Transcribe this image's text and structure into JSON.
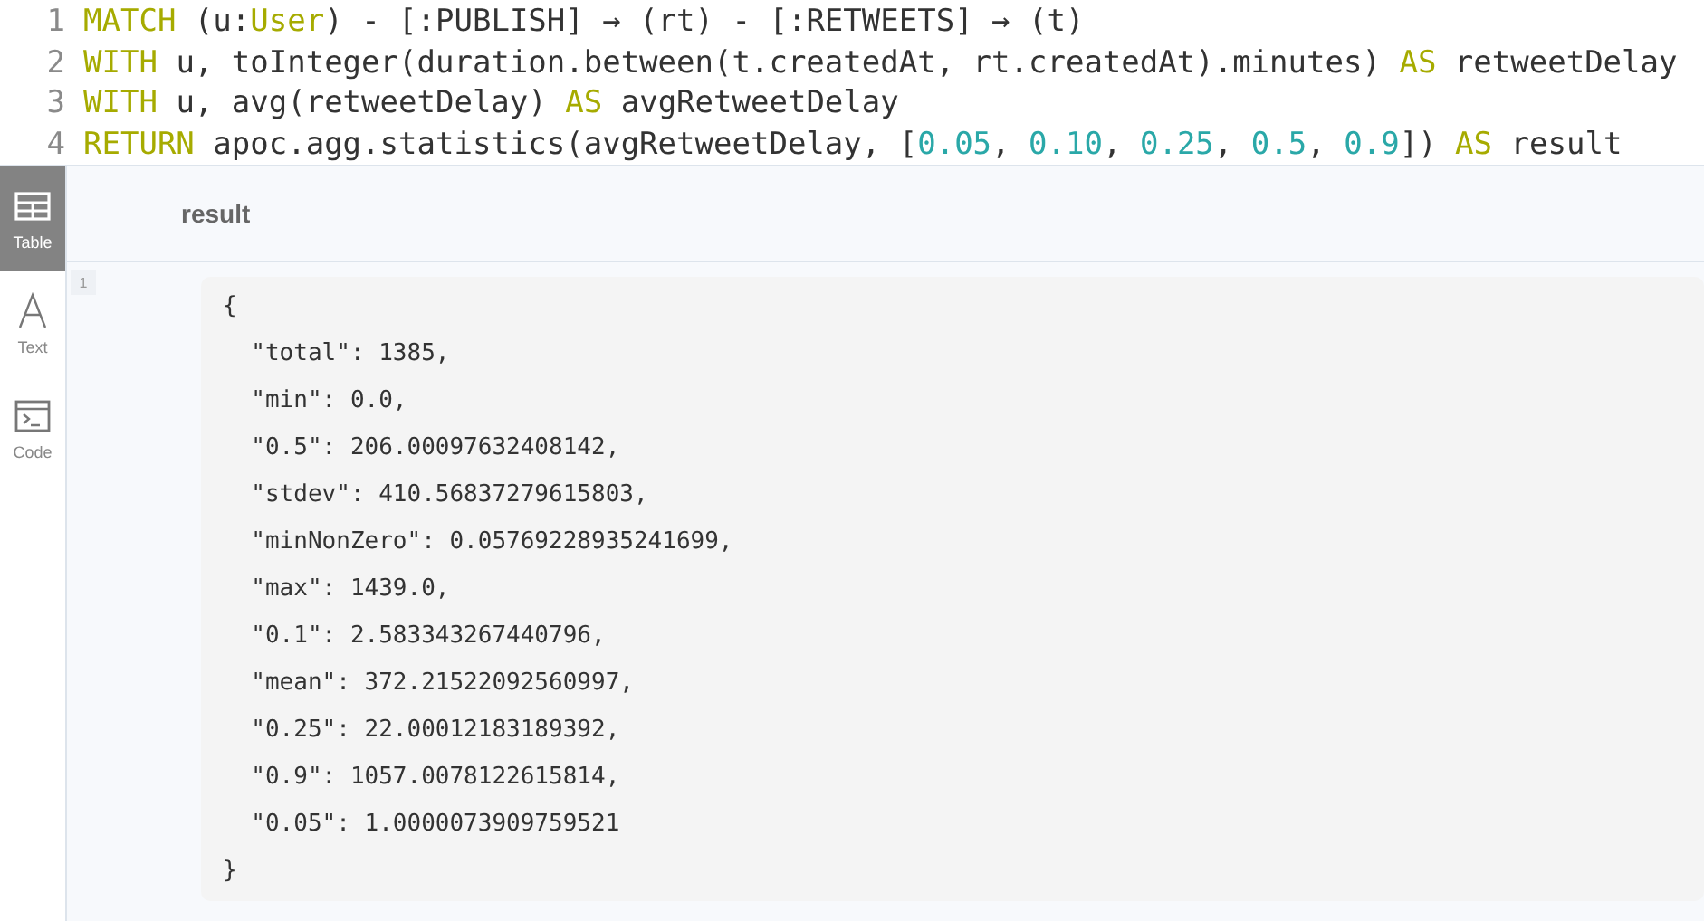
{
  "editor": {
    "lines": [
      {
        "number": "1",
        "tokens": [
          {
            "kind": "keyword",
            "text": "MATCH"
          },
          {
            "kind": "plain",
            "text": " (u:"
          },
          {
            "kind": "label",
            "text": "User"
          },
          {
            "kind": "plain",
            "text": ") - [:PUBLISH] → (rt) - [:RETWEETS] → (t)"
          }
        ]
      },
      {
        "number": "2",
        "tokens": [
          {
            "kind": "keyword",
            "text": "WITH"
          },
          {
            "kind": "plain",
            "text": " u, toInteger(duration.between(t.createdAt, rt.createdAt).minutes) "
          },
          {
            "kind": "keyword",
            "text": "AS"
          },
          {
            "kind": "plain",
            "text": " retweetDelay"
          }
        ]
      },
      {
        "number": "3",
        "tokens": [
          {
            "kind": "keyword",
            "text": "WITH"
          },
          {
            "kind": "plain",
            "text": " u, avg(retweetDelay) "
          },
          {
            "kind": "keyword",
            "text": "AS"
          },
          {
            "kind": "plain",
            "text": " avgRetweetDelay"
          }
        ]
      },
      {
        "number": "4",
        "tokens": [
          {
            "kind": "keyword",
            "text": "RETURN"
          },
          {
            "kind": "plain",
            "text": " apoc.agg.statistics(avgRetweetDelay, ["
          },
          {
            "kind": "number",
            "text": "0.05"
          },
          {
            "kind": "plain",
            "text": ", "
          },
          {
            "kind": "number",
            "text": "0.10"
          },
          {
            "kind": "plain",
            "text": ", "
          },
          {
            "kind": "number",
            "text": "0.25"
          },
          {
            "kind": "plain",
            "text": ", "
          },
          {
            "kind": "number",
            "text": "0.5"
          },
          {
            "kind": "plain",
            "text": ", "
          },
          {
            "kind": "number",
            "text": "0.9"
          },
          {
            "kind": "plain",
            "text": "]) "
          },
          {
            "kind": "keyword",
            "text": "AS"
          },
          {
            "kind": "plain",
            "text": " result"
          }
        ]
      }
    ]
  },
  "sidebar": {
    "items": [
      {
        "kind": "table",
        "label": "Table",
        "selected": true
      },
      {
        "kind": "text",
        "label": "Text",
        "selected": false
      },
      {
        "kind": "code",
        "label": "Code",
        "selected": false
      }
    ]
  },
  "table": {
    "columns": [
      "result"
    ],
    "rows": [
      {
        "number": "1",
        "lines": [
          "{",
          "  \"total\": 1385,",
          "  \"min\": 0.0,",
          "  \"0.5\": 206.00097632408142,",
          "  \"stdev\": 410.56837279615803,",
          "  \"minNonZero\": 0.05769228935241699,",
          "  \"max\": 1439.0,",
          "  \"0.1\": 2.583343267440796,",
          "  \"mean\": 372.21522092560997,",
          "  \"0.25\": 22.00012183189392,",
          "  \"0.9\": 1057.0078122615814,",
          "  \"0.05\": 1.0000073909759521",
          "}"
        ]
      }
    ]
  }
}
